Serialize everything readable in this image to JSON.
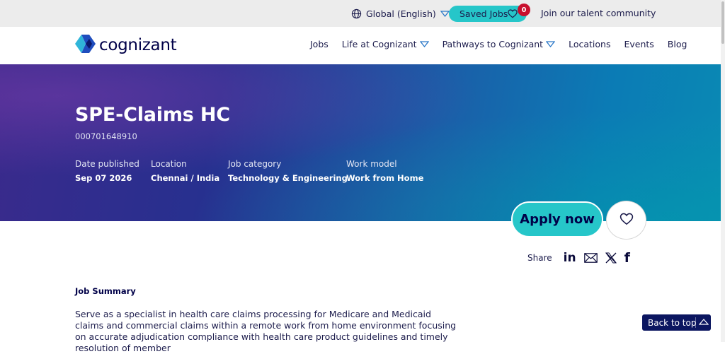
{
  "utility_bar": {
    "language": "Global (English)",
    "saved_jobs_label": "Saved Jobs",
    "saved_jobs_count": "0",
    "join_label": "Join our talent community"
  },
  "brand": {
    "name": "cognizant"
  },
  "nav": {
    "items": [
      {
        "label": "Jobs",
        "has_dropdown": false
      },
      {
        "label": "Life at Cognizant",
        "has_dropdown": true
      },
      {
        "label": "Pathways to Cognizant",
        "has_dropdown": true
      },
      {
        "label": "Locations",
        "has_dropdown": false
      },
      {
        "label": "Events",
        "has_dropdown": false
      },
      {
        "label": "Blog",
        "has_dropdown": false
      }
    ]
  },
  "job": {
    "title": "SPE-Claims HC",
    "id": "000701648910",
    "meta": [
      {
        "label": "Date published",
        "value": "Sep 07 2026"
      },
      {
        "label": "Location",
        "value": "Chennai / India"
      },
      {
        "label": "Job category",
        "value": "Technology & Engineering"
      },
      {
        "label": "Work model",
        "value": "Work from Home"
      }
    ]
  },
  "actions": {
    "apply_label": "Apply now",
    "share_label": "Share",
    "share_icons": [
      "linkedin-icon",
      "email-icon",
      "x-icon",
      "facebook-icon"
    ]
  },
  "summary": {
    "heading": "Job Summary",
    "text": "Serve as a specialist in health care claims processing for Medicare and Medicaid claims and commercial claims within a remote work from home environment focusing on accurate adjudication compliance with health care product guidelines and timely resolution of member"
  },
  "back_to_top_label": "Back to top",
  "colors": {
    "accent_teal": "#26c6c9",
    "brand_navy": "#000048",
    "badge_red": "#c8102e",
    "back_to_top_bg": "#0b1660",
    "hero_start": "#3a2a8c",
    "hero_end": "#0a8ab4"
  }
}
